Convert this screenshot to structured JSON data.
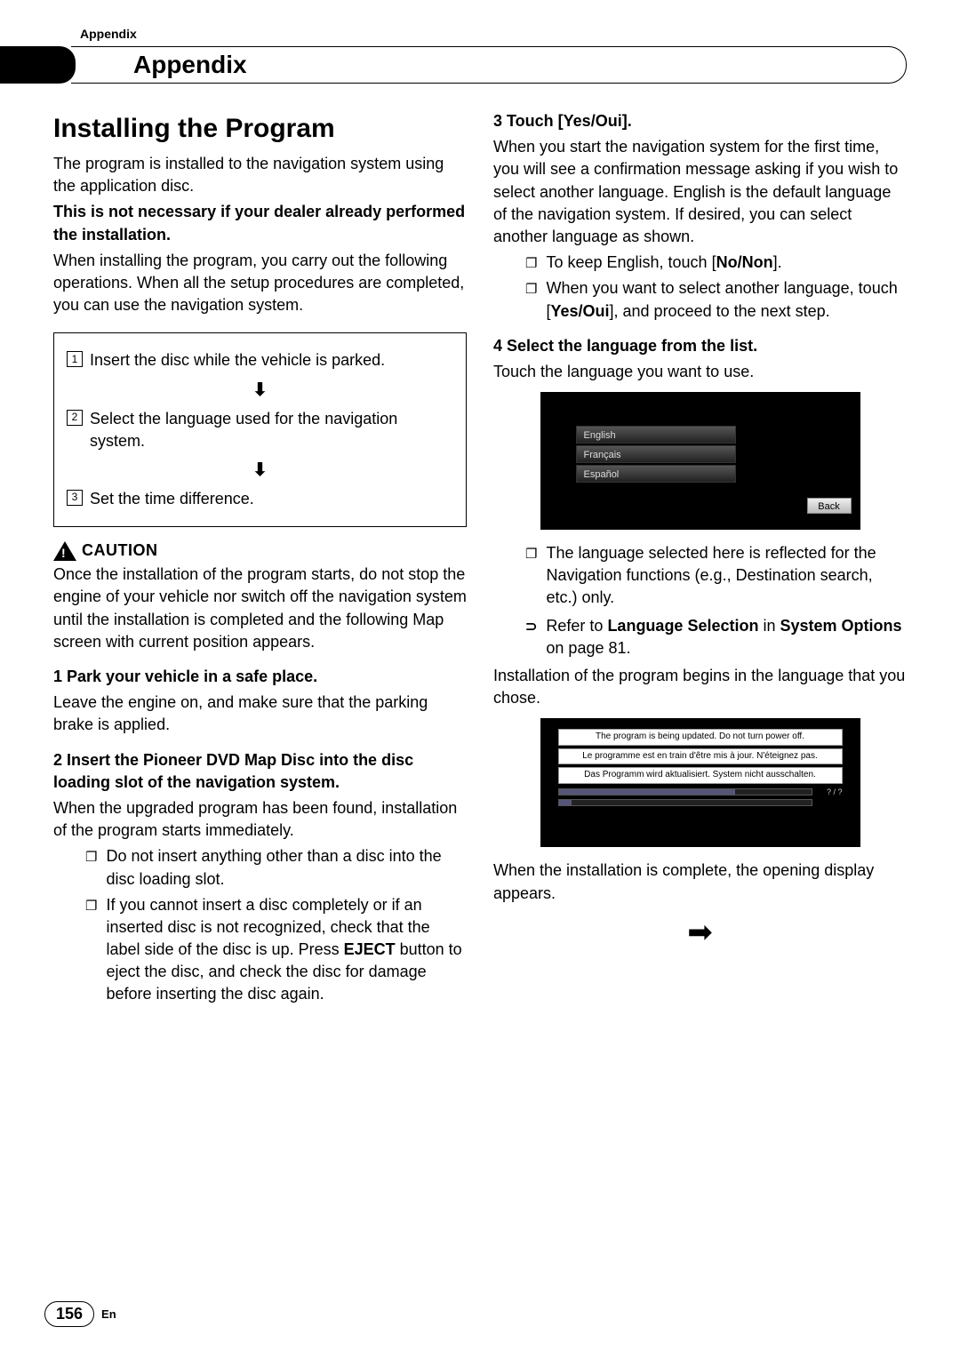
{
  "header": {
    "breadcrumb": "Appendix",
    "chapter_title": "Appendix"
  },
  "left": {
    "section_title": "Installing the Program",
    "intro1": "The program is installed to the navigation system using the application disc.",
    "intro2": "This is not necessary if your dealer already performed the installation.",
    "intro3": "When installing the program, you carry out the following operations. When all the setup procedures are completed, you can use the navigation system.",
    "flow": {
      "s1_num": "1",
      "s1": "Insert the disc while the vehicle is parked.",
      "s2_num": "2",
      "s2": "Select the language used for the navigation system.",
      "s3_num": "3",
      "s3": "Set the time difference."
    },
    "caution_label": "CAUTION",
    "caution_body": "Once the installation of the program starts, do not stop the engine of your vehicle nor switch off the navigation system until the installation is completed and the following Map screen with current position appears.",
    "step1_head": "1   Park your vehicle in a safe place.",
    "step1_body": "Leave the engine on, and make sure that the parking brake is applied.",
    "step2_head": "2   Insert the Pioneer DVD Map Disc into the disc loading slot of the navigation system.",
    "step2_body": "When the upgraded program has been found, installation of the program starts immediately.",
    "step2_b1": "Do not insert anything other than a disc into the disc loading slot.",
    "step2_b2a": "If you cannot insert a disc completely or if an inserted disc is not recognized, check that the label side of the disc is up. Press ",
    "step2_b2_eject": "EJECT",
    "step2_b2b": " button to eject the disc, and check the disc for damage before inserting the disc again."
  },
  "right": {
    "step3_head": "3   Touch [Yes/Oui].",
    "step3_body": "When you start the navigation system for the first time, you will see a confirmation message asking if you wish to select another language. English is the default language of the navigation system. If desired, you can select another language as shown.",
    "step3_b1a": "To keep English, touch [",
    "step3_b1_bold": "No/Non",
    "step3_b1b": "].",
    "step3_b2a": "When you want to select another language, touch [",
    "step3_b2_bold": "Yes/Oui",
    "step3_b2b": "], and proceed to the next step.",
    "step4_head": "4   Select the language from the list.",
    "step4_body": "Touch the language you want to use.",
    "lang_items": [
      "English",
      "Français",
      "Español"
    ],
    "lang_back": "Back",
    "step4_note1": "The language selected here is reflected for the Navigation functions (e.g., Destination search, etc.) only.",
    "step4_ref_a": "Refer to ",
    "step4_ref_bold1": "Language Selection",
    "step4_ref_mid": " in ",
    "step4_ref_bold2": "System Options",
    "step4_ref_b": " on page 81.",
    "install_begin": "Installation of the program begins in the language that you chose.",
    "install_msgs": [
      "The program is being updated.\nDo not turn power off.",
      "Le programme est en train d'être mis à jour.\nN'éteignez pas.",
      "Das Programm wird aktualisiert.\nSystem nicht ausschalten."
    ],
    "install_pct": "? / ?",
    "install_done": "When the installation is complete, the opening display appears.",
    "arrow": "➡"
  },
  "footer": {
    "page": "156",
    "lang": "En"
  }
}
